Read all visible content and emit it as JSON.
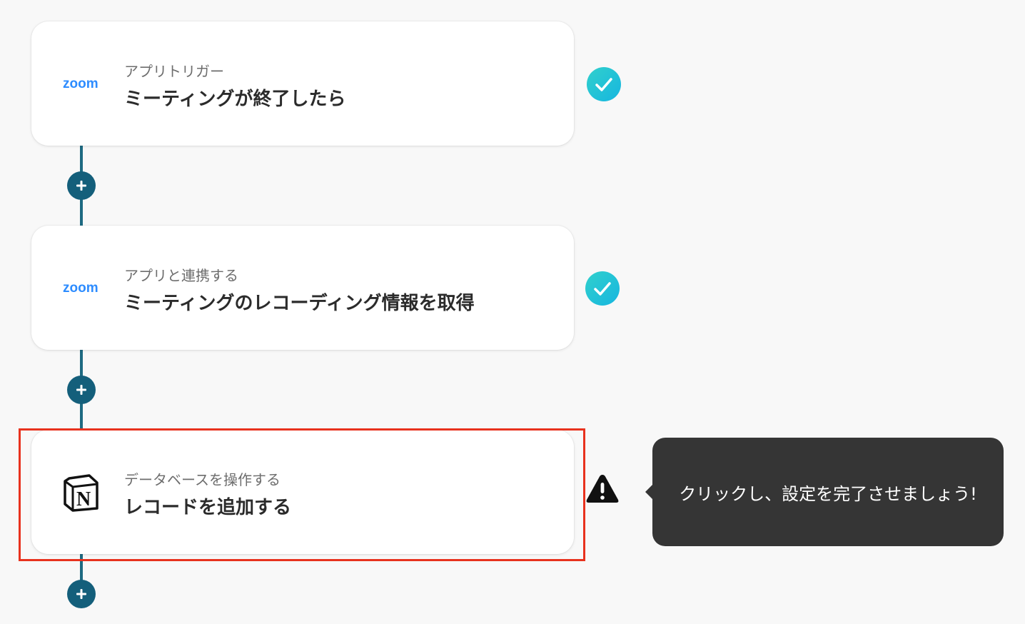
{
  "steps": [
    {
      "app": "zoom",
      "logo_text": "zoom",
      "subtitle": "アプリトリガー",
      "title": "ミーティングが終了したら",
      "status": "complete"
    },
    {
      "app": "zoom",
      "logo_text": "zoom",
      "subtitle": "アプリと連携する",
      "title": "ミーティングのレコーディング情報を取得",
      "status": "complete"
    },
    {
      "app": "notion",
      "logo_text": "N",
      "subtitle": "データベースを操作する",
      "title": "レコードを追加する",
      "status": "warning",
      "highlighted": true
    }
  ],
  "tooltip": {
    "text": "クリックし、設定を完了させましょう!"
  },
  "icons": {
    "add": "plus-icon",
    "complete": "check-circle-icon",
    "warning": "warning-triangle-icon"
  },
  "colors": {
    "connector": "#1e6a82",
    "add_button": "#145f7b",
    "check_start": "#31d0cc",
    "check_end": "#16b6e0",
    "highlight_border": "#e8321e",
    "tooltip_bg": "#353535",
    "zoom_blue": "#2d8cff"
  }
}
